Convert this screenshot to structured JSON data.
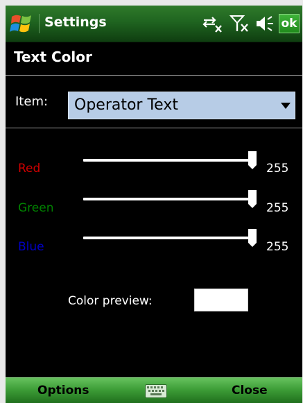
{
  "titlebar": {
    "title": "Settings",
    "ok_label": "ok",
    "icons": [
      "windows-start-icon",
      "connectivity-icon",
      "signal-off-icon",
      "volume-icon"
    ]
  },
  "page": {
    "header": "Text Color"
  },
  "item": {
    "label": "Item:",
    "selected": "Operator Text"
  },
  "sliders": [
    {
      "label": "Red",
      "value_text": "255",
      "value": 255,
      "max": 255,
      "color": "#d00000"
    },
    {
      "label": "Green",
      "value_text": "255",
      "value": 255,
      "max": 255,
      "color": "#008000"
    },
    {
      "label": "Blue",
      "value_text": "255",
      "value": 255,
      "max": 255,
      "color": "#0000c8"
    }
  ],
  "preview": {
    "label": "Color preview:",
    "color": "#ffffff"
  },
  "softkeys": {
    "left": "Options",
    "right": "Close",
    "center_icon": "keyboard-icon"
  },
  "colors": {
    "titlebar_green": "#1f6420",
    "softkey_green": "#3d9d37",
    "select_bg": "#b7cce6"
  }
}
